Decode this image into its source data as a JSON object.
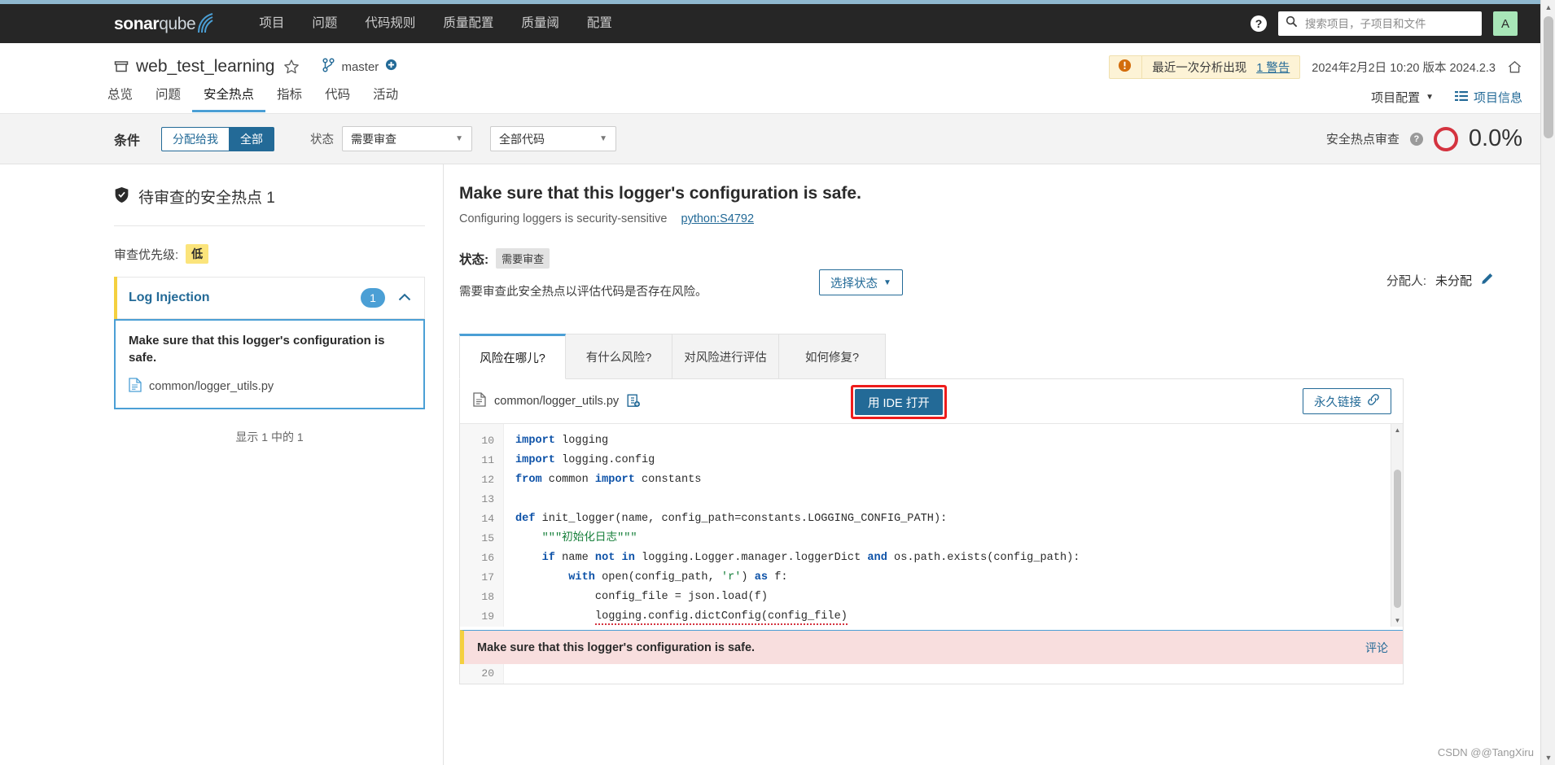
{
  "globalnav": {
    "logo_bold": "sonar",
    "logo_light": "qube",
    "items": [
      {
        "label": "项目"
      },
      {
        "label": "问题"
      },
      {
        "label": "代码规则"
      },
      {
        "label": "质量配置"
      },
      {
        "label": "质量阈"
      },
      {
        "label": "配置"
      }
    ],
    "help": "?",
    "search_placeholder": "搜索项目，子项目和文件",
    "search_value": "",
    "avatar_initial": "A"
  },
  "project": {
    "name": "web_test_learning",
    "branch": "master",
    "warning_text": "最近一次分析出现",
    "warning_link": "1 警告",
    "analysis_meta": "2024年2月2日 10:20  版本 2024.2.3",
    "tabs": [
      {
        "label": "总览"
      },
      {
        "label": "问题"
      },
      {
        "label": "安全热点"
      },
      {
        "label": "指标"
      },
      {
        "label": "代码"
      },
      {
        "label": "活动"
      }
    ],
    "config_label": "项目配置",
    "info_label": "项目信息"
  },
  "filterbar": {
    "title": "条件",
    "toggle_assigned": "分配给我",
    "toggle_all": "全部",
    "status_label": "状态",
    "status_value": "需要审查",
    "scope_value": "全部代码",
    "review_label": "安全热点审查",
    "review_help": "?",
    "review_percent": "0.0%"
  },
  "sidebar": {
    "header": "待审查的安全热点 1",
    "priority_label": "审查优先级:",
    "priority_value": "低",
    "category": {
      "name": "Log Injection",
      "count": "1"
    },
    "hotspot": {
      "message": "Make sure that this logger's configuration is safe.",
      "file": "common/logger_utils.py"
    },
    "footer": "显示 1 中的 1"
  },
  "detail": {
    "title": "Make sure that this logger's configuration is safe.",
    "rule_desc": "Configuring loggers is security-sensitive",
    "rule_key": "python:S4792",
    "status_label": "状态:",
    "status_value": "需要审查",
    "status_desc": "需要审查此安全热点以评估代码是否存在风险。",
    "status_button": "选择状态",
    "assignee_label": "分配人:",
    "assignee_value": "未分配",
    "tabs": [
      {
        "label": "风险在哪儿?"
      },
      {
        "label": "有什么风险?"
      },
      {
        "label": "对风险进行评估"
      },
      {
        "label": "如何修复?"
      }
    ],
    "file_name": "common/logger_utils.py",
    "open_ide_button": "用 IDE 打开",
    "permalink_button": "永久链接",
    "code": {
      "line_numbers": [
        "10",
        "11",
        "12",
        "13",
        "14",
        "15",
        "16",
        "17",
        "18",
        "19"
      ],
      "lines": [
        "import logging",
        "import logging.config",
        "from common import constants",
        "",
        "def init_logger(name, config_path=constants.LOGGING_CONFIG_PATH):",
        "    \"\"\"初始化日志\"\"\"",
        "    if name not in logging.Logger.manager.loggerDict and os.path.exists(config_path):",
        "        with open(config_path, 'r') as f:",
        "            config_file = json.load(f)",
        "            logging.config.dictConfig(config_file)"
      ],
      "trailing_line_number": "20"
    },
    "issue": {
      "message": "Make sure that this logger's configuration is safe.",
      "comment_link": "评论"
    }
  },
  "watermark": "CSDN @@TangXiru",
  "colors": {
    "nav_bg": "#262626",
    "accent_blue": "#236a97",
    "light_blue": "#4b9fd5",
    "rating_red": "#d4333f",
    "priority_yellow": "#fbe47b",
    "issue_pink": "#f8dede",
    "avatar_green": "#a8e6b8",
    "highlight_red": "#ee1c1c"
  }
}
